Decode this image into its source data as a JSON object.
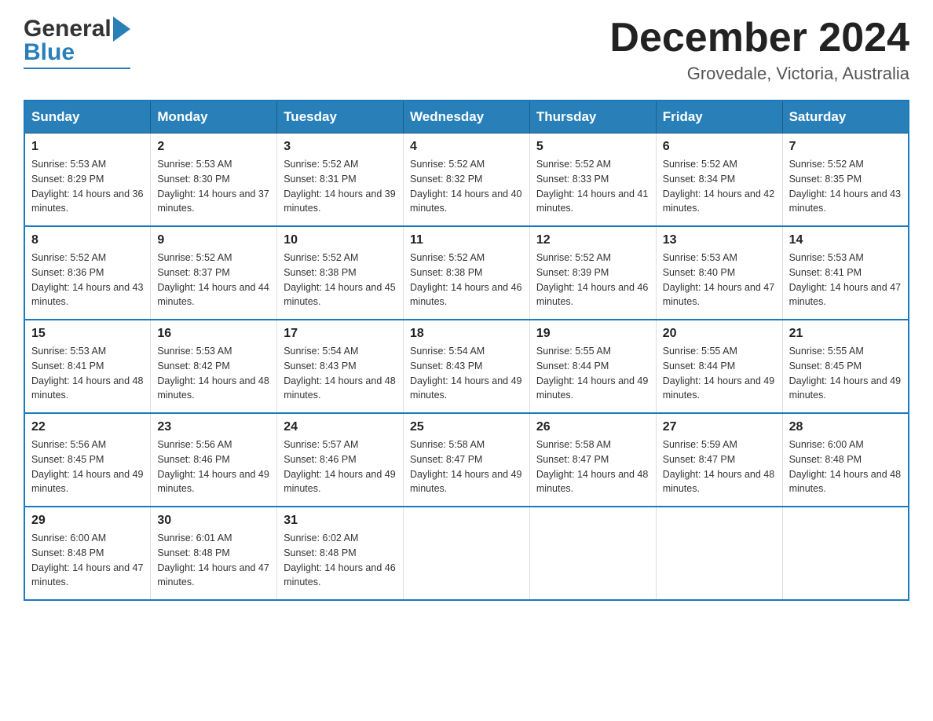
{
  "header": {
    "logo": {
      "general": "General",
      "blue": "Blue"
    },
    "title": "December 2024",
    "location": "Grovedale, Victoria, Australia"
  },
  "calendar": {
    "columns": [
      "Sunday",
      "Monday",
      "Tuesday",
      "Wednesday",
      "Thursday",
      "Friday",
      "Saturday"
    ],
    "weeks": [
      [
        {
          "day": 1,
          "sunrise": "5:53 AM",
          "sunset": "8:29 PM",
          "daylight": "14 hours and 36 minutes."
        },
        {
          "day": 2,
          "sunrise": "5:53 AM",
          "sunset": "8:30 PM",
          "daylight": "14 hours and 37 minutes."
        },
        {
          "day": 3,
          "sunrise": "5:52 AM",
          "sunset": "8:31 PM",
          "daylight": "14 hours and 39 minutes."
        },
        {
          "day": 4,
          "sunrise": "5:52 AM",
          "sunset": "8:32 PM",
          "daylight": "14 hours and 40 minutes."
        },
        {
          "day": 5,
          "sunrise": "5:52 AM",
          "sunset": "8:33 PM",
          "daylight": "14 hours and 41 minutes."
        },
        {
          "day": 6,
          "sunrise": "5:52 AM",
          "sunset": "8:34 PM",
          "daylight": "14 hours and 42 minutes."
        },
        {
          "day": 7,
          "sunrise": "5:52 AM",
          "sunset": "8:35 PM",
          "daylight": "14 hours and 43 minutes."
        }
      ],
      [
        {
          "day": 8,
          "sunrise": "5:52 AM",
          "sunset": "8:36 PM",
          "daylight": "14 hours and 43 minutes."
        },
        {
          "day": 9,
          "sunrise": "5:52 AM",
          "sunset": "8:37 PM",
          "daylight": "14 hours and 44 minutes."
        },
        {
          "day": 10,
          "sunrise": "5:52 AM",
          "sunset": "8:38 PM",
          "daylight": "14 hours and 45 minutes."
        },
        {
          "day": 11,
          "sunrise": "5:52 AM",
          "sunset": "8:38 PM",
          "daylight": "14 hours and 46 minutes."
        },
        {
          "day": 12,
          "sunrise": "5:52 AM",
          "sunset": "8:39 PM",
          "daylight": "14 hours and 46 minutes."
        },
        {
          "day": 13,
          "sunrise": "5:53 AM",
          "sunset": "8:40 PM",
          "daylight": "14 hours and 47 minutes."
        },
        {
          "day": 14,
          "sunrise": "5:53 AM",
          "sunset": "8:41 PM",
          "daylight": "14 hours and 47 minutes."
        }
      ],
      [
        {
          "day": 15,
          "sunrise": "5:53 AM",
          "sunset": "8:41 PM",
          "daylight": "14 hours and 48 minutes."
        },
        {
          "day": 16,
          "sunrise": "5:53 AM",
          "sunset": "8:42 PM",
          "daylight": "14 hours and 48 minutes."
        },
        {
          "day": 17,
          "sunrise": "5:54 AM",
          "sunset": "8:43 PM",
          "daylight": "14 hours and 48 minutes."
        },
        {
          "day": 18,
          "sunrise": "5:54 AM",
          "sunset": "8:43 PM",
          "daylight": "14 hours and 49 minutes."
        },
        {
          "day": 19,
          "sunrise": "5:55 AM",
          "sunset": "8:44 PM",
          "daylight": "14 hours and 49 minutes."
        },
        {
          "day": 20,
          "sunrise": "5:55 AM",
          "sunset": "8:44 PM",
          "daylight": "14 hours and 49 minutes."
        },
        {
          "day": 21,
          "sunrise": "5:55 AM",
          "sunset": "8:45 PM",
          "daylight": "14 hours and 49 minutes."
        }
      ],
      [
        {
          "day": 22,
          "sunrise": "5:56 AM",
          "sunset": "8:45 PM",
          "daylight": "14 hours and 49 minutes."
        },
        {
          "day": 23,
          "sunrise": "5:56 AM",
          "sunset": "8:46 PM",
          "daylight": "14 hours and 49 minutes."
        },
        {
          "day": 24,
          "sunrise": "5:57 AM",
          "sunset": "8:46 PM",
          "daylight": "14 hours and 49 minutes."
        },
        {
          "day": 25,
          "sunrise": "5:58 AM",
          "sunset": "8:47 PM",
          "daylight": "14 hours and 49 minutes."
        },
        {
          "day": 26,
          "sunrise": "5:58 AM",
          "sunset": "8:47 PM",
          "daylight": "14 hours and 48 minutes."
        },
        {
          "day": 27,
          "sunrise": "5:59 AM",
          "sunset": "8:47 PM",
          "daylight": "14 hours and 48 minutes."
        },
        {
          "day": 28,
          "sunrise": "6:00 AM",
          "sunset": "8:48 PM",
          "daylight": "14 hours and 48 minutes."
        }
      ],
      [
        {
          "day": 29,
          "sunrise": "6:00 AM",
          "sunset": "8:48 PM",
          "daylight": "14 hours and 47 minutes."
        },
        {
          "day": 30,
          "sunrise": "6:01 AM",
          "sunset": "8:48 PM",
          "daylight": "14 hours and 47 minutes."
        },
        {
          "day": 31,
          "sunrise": "6:02 AM",
          "sunset": "8:48 PM",
          "daylight": "14 hours and 46 minutes."
        },
        null,
        null,
        null,
        null
      ]
    ]
  }
}
